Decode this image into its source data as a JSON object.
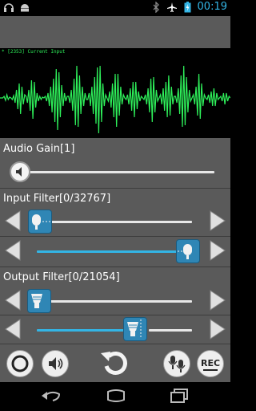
{
  "status": {
    "clock": "00:19"
  },
  "waveform": {
    "label": "* [2353] Current Input",
    "color": "#2ef05a",
    "samples": [
      0,
      0,
      0,
      2,
      -3,
      4,
      -2,
      1,
      0,
      -2,
      3,
      -6,
      10,
      -14,
      18,
      -20,
      14,
      -8,
      4,
      2,
      -6,
      10,
      -16,
      22,
      -26,
      20,
      -12,
      6,
      -4,
      2,
      -2,
      1,
      0,
      2,
      -4,
      6,
      -10,
      14,
      -18,
      24,
      -30,
      36,
      -40,
      32,
      -24,
      16,
      -10,
      6,
      -4,
      2,
      2,
      -6,
      10,
      -16,
      24,
      -34,
      40,
      -36,
      28,
      -20,
      14,
      -10,
      6,
      -2,
      -2,
      6,
      -10,
      14,
      -20,
      26,
      -32,
      38,
      -44,
      40,
      -30,
      18,
      -10,
      4,
      0,
      -4,
      8,
      -12,
      18,
      -24,
      30,
      -36,
      30,
      -22,
      14,
      -8,
      4,
      0,
      -2,
      4,
      -8,
      12,
      -16,
      20,
      -24,
      20,
      -14,
      8,
      -4,
      2,
      0,
      -2,
      4,
      -8,
      12,
      -18,
      24,
      -30,
      26,
      -18,
      10,
      -4,
      0,
      4,
      -8,
      12,
      -16,
      20,
      -24,
      28,
      -22,
      14,
      -8,
      2,
      2,
      -6,
      12,
      -20,
      28,
      -36,
      40,
      -34,
      26,
      -18,
      10,
      -4,
      0,
      4,
      -8,
      14,
      -22,
      30,
      -26,
      18,
      -10,
      4,
      0,
      -2,
      4,
      -6,
      8,
      -10,
      12,
      -10,
      6,
      -2,
      0,
      2,
      -4,
      6,
      -8,
      6,
      -4,
      2,
      0
    ]
  },
  "audio_gain": {
    "title": "Audio Gain[1]",
    "level": 0.0
  },
  "input_filter": {
    "title": "Input Filter[0/32767]",
    "low": 0.0,
    "high": 1.0
  },
  "output_filter": {
    "title": "Output Filter[0/21054]",
    "low": 0.0,
    "high": 0.6
  },
  "toolbar": {
    "buttons": [
      "record-circle-icon",
      "speaker-icon",
      "reset-icon",
      "mic-compare-icon",
      "rec-icon"
    ],
    "rec_label": "REC"
  },
  "colors": {
    "accent": "#33b5e5",
    "knob_blue": "#2f86b5",
    "wave": "#2ef05a",
    "panel": "#5a5a5a"
  }
}
